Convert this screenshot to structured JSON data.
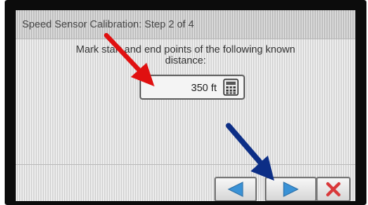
{
  "dialog": {
    "title": "Speed Sensor Calibration:  Step 2 of 4",
    "instruction_line1": "Mark start and end points of the following known",
    "instruction_line2": "distance:"
  },
  "distance_field": {
    "value": "350 ft",
    "icon": "calculator-icon"
  },
  "navigation": {
    "back_icon": "arrow-left-icon",
    "next_icon": "arrow-right-icon",
    "cancel_icon": "close-x-icon"
  },
  "colors": {
    "nav_arrow": "#3a92d6",
    "cancel_x": "#d9383a",
    "annotation_red": "#e01010",
    "annotation_blue": "#0c2e86"
  }
}
